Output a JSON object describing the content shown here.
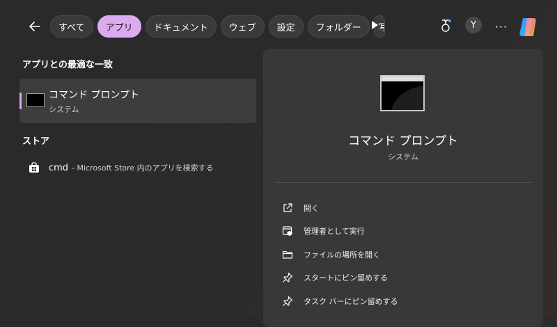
{
  "filters": {
    "tabs": [
      {
        "label": "すべて"
      },
      {
        "label": "アプリ"
      },
      {
        "label": "ドキュメント"
      },
      {
        "label": "ウェブ"
      },
      {
        "label": "設定"
      },
      {
        "label": "フォルダー"
      },
      {
        "label": "写"
      }
    ]
  },
  "header": {
    "avatar_initial": "Y",
    "more_label": "···"
  },
  "left": {
    "best_match_title": "アプリとの最適な一致",
    "best_match": {
      "name": "コマンド プロンプト",
      "type": "システム"
    },
    "store_title": "ストア",
    "store_item": {
      "query": "cmd",
      "desc": "- Microsoft Store 内のアプリを検索する"
    }
  },
  "preview": {
    "name": "コマンド プロンプト",
    "type": "システム",
    "actions": [
      {
        "label": "開く",
        "icon": "open-external-icon"
      },
      {
        "label": "管理者として実行",
        "icon": "run-as-admin-icon"
      },
      {
        "label": "ファイルの場所を開く",
        "icon": "folder-icon"
      },
      {
        "label": "スタートにピン留めする",
        "icon": "pin-icon"
      },
      {
        "label": "タスク バーにピン留めする",
        "icon": "pin-icon"
      }
    ]
  },
  "colors": {
    "accent": "#dcaaf0",
    "panel": "#383838",
    "selected": "#3d3d3d"
  }
}
